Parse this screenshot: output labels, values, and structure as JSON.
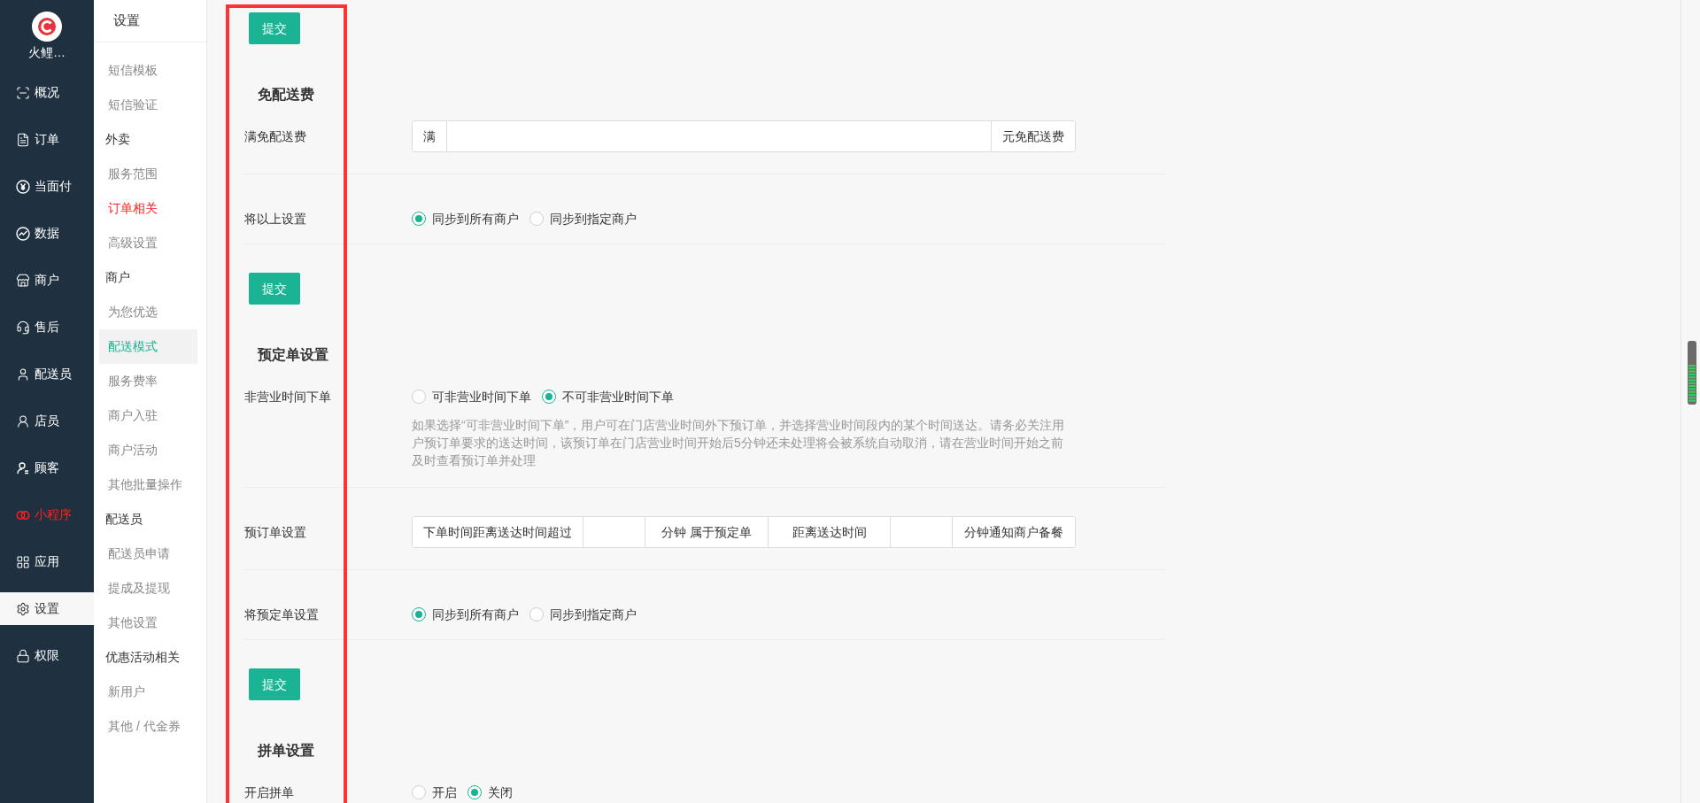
{
  "nav": {
    "logo_text": "火鲤…",
    "items": [
      {
        "label": "概况",
        "selected": false,
        "highlighted": false
      },
      {
        "label": "订单",
        "selected": false,
        "highlighted": false
      },
      {
        "label": "当面付",
        "selected": false,
        "highlighted": false
      },
      {
        "label": "数据",
        "selected": false,
        "highlighted": false
      },
      {
        "label": "商户",
        "selected": false,
        "highlighted": false
      },
      {
        "label": "售后",
        "selected": false,
        "highlighted": false
      },
      {
        "label": "配送员",
        "selected": false,
        "highlighted": false
      },
      {
        "label": "店员",
        "selected": false,
        "highlighted": false
      },
      {
        "label": "顾客",
        "selected": false,
        "highlighted": false
      },
      {
        "label": "小程序",
        "selected": false,
        "highlighted": true
      },
      {
        "label": "应用",
        "selected": false,
        "highlighted": false
      },
      {
        "label": "设置",
        "selected": true,
        "highlighted": false
      },
      {
        "label": "权限",
        "selected": false,
        "highlighted": false
      }
    ]
  },
  "submenu": {
    "title": "设置",
    "items": [
      {
        "kind": "link",
        "label": "短信模板",
        "selected": false,
        "highlighted": false
      },
      {
        "kind": "link",
        "label": "短信验证",
        "selected": false,
        "highlighted": false
      },
      {
        "kind": "group",
        "label": "外卖"
      },
      {
        "kind": "link",
        "label": "服务范围",
        "selected": false,
        "highlighted": false
      },
      {
        "kind": "link",
        "label": "订单相关",
        "selected": false,
        "highlighted": true
      },
      {
        "kind": "link",
        "label": "高级设置",
        "selected": false,
        "highlighted": false
      },
      {
        "kind": "group",
        "label": "商户"
      },
      {
        "kind": "link",
        "label": "为您优选",
        "selected": false,
        "highlighted": false
      },
      {
        "kind": "link",
        "label": "配送模式",
        "selected": true,
        "highlighted": false
      },
      {
        "kind": "link",
        "label": "服务费率",
        "selected": false,
        "highlighted": false
      },
      {
        "kind": "link",
        "label": "商户入驻",
        "selected": false,
        "highlighted": false
      },
      {
        "kind": "link",
        "label": "商户活动",
        "selected": false,
        "highlighted": false
      },
      {
        "kind": "link",
        "label": "其他批量操作",
        "selected": false,
        "highlighted": false
      },
      {
        "kind": "group",
        "label": "配送员"
      },
      {
        "kind": "link",
        "label": "配送员申请",
        "selected": false,
        "highlighted": false
      },
      {
        "kind": "link",
        "label": "提成及提现",
        "selected": false,
        "highlighted": false
      },
      {
        "kind": "link",
        "label": "其他设置",
        "selected": false,
        "highlighted": false
      },
      {
        "kind": "group",
        "label": "优惠活动相关"
      },
      {
        "kind": "link",
        "label": "新用户",
        "selected": false,
        "highlighted": false
      },
      {
        "kind": "link",
        "label": "其他 / 代金券",
        "selected": false,
        "highlighted": false
      }
    ]
  },
  "form": [
    {
      "kind": "submit",
      "label": "提交"
    },
    {
      "kind": "heading",
      "text": "免配送费"
    },
    {
      "kind": "input_group",
      "label": "满免配送费",
      "parts": [
        {
          "kind": "addon",
          "text": "满"
        },
        {
          "kind": "input"
        },
        {
          "kind": "addon",
          "text": "元免配送费"
        }
      ]
    },
    {
      "kind": "radio",
      "label": "将以上设置",
      "options": [
        {
          "label": "同步到所有商户",
          "selected": true
        },
        {
          "label": "同步到指定商户",
          "selected": false
        }
      ]
    },
    {
      "kind": "submit",
      "label": "提交"
    },
    {
      "kind": "heading",
      "text": "预定单设置"
    },
    {
      "kind": "radio",
      "label": "非营业时间下单",
      "options": [
        {
          "label": "可非营业时间下单",
          "selected": false
        },
        {
          "label": "不可非营业时间下单",
          "selected": true
        }
      ],
      "help": "如果选择“可非营业时间下单”，用户可在门店营业时间外下预订单，并选择营业时间段内的某个时间送达。请务必关注用户预订单要求的送达时间，该预订单在门店营业时间开始后5分钟还未处理将会被系统自动取消，请在营业时间开始之前及时查看预订单并处理"
    },
    {
      "kind": "input_group",
      "label": "预订单设置",
      "parts": [
        {
          "kind": "addon",
          "text": "下单时间距离送达时间超过"
        },
        {
          "kind": "input"
        },
        {
          "kind": "addon",
          "text": "分钟 属于预定单"
        },
        {
          "kind": "addon",
          "text": "距离送达时间"
        },
        {
          "kind": "input"
        },
        {
          "kind": "addon",
          "text": "分钟通知商户备餐"
        }
      ]
    },
    {
      "kind": "radio",
      "label": "将预定单设置",
      "options": [
        {
          "label": "同步到所有商户",
          "selected": true
        },
        {
          "label": "同步到指定商户",
          "selected": false
        }
      ]
    },
    {
      "kind": "submit",
      "label": "提交"
    },
    {
      "kind": "heading",
      "text": "拼单设置"
    },
    {
      "kind": "radio",
      "label": "开启拼单",
      "options": [
        {
          "label": "开启",
          "selected": false
        },
        {
          "label": "关闭",
          "selected": true
        }
      ]
    }
  ]
}
